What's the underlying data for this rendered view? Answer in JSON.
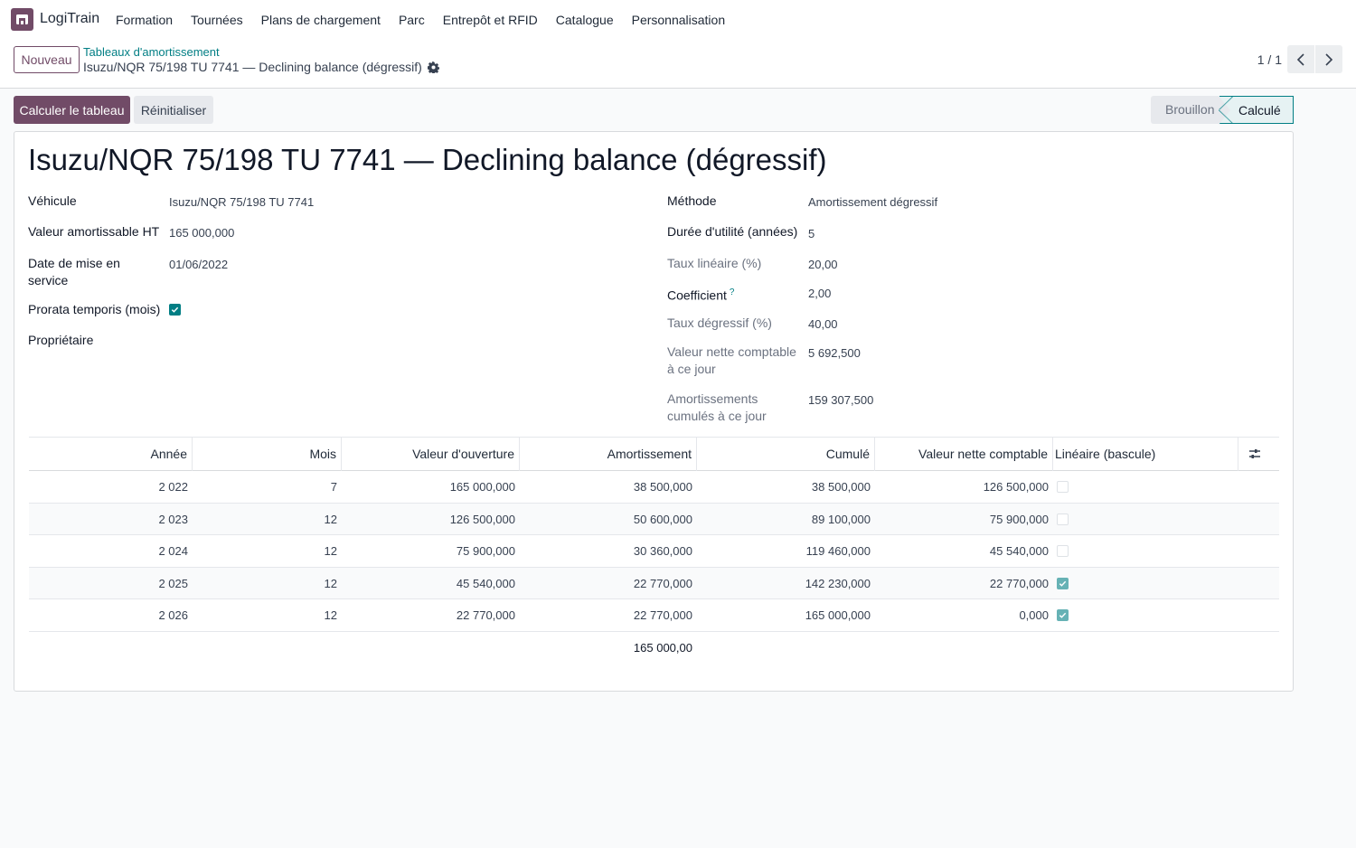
{
  "app": {
    "name": "LogiTrain"
  },
  "menu": [
    {
      "label": "Formation"
    },
    {
      "label": "Tournées"
    },
    {
      "label": "Plans de chargement"
    },
    {
      "label": "Parc"
    },
    {
      "label": "Entrepôt et RFID"
    },
    {
      "label": "Catalogue"
    },
    {
      "label": "Personnalisation"
    }
  ],
  "control": {
    "new_label": "Nouveau",
    "breadcrumb_parent": "Tableaux d'amortissement",
    "breadcrumb_current": "Isuzu/NQR 75/198 TU 7741 — Declining balance (dégressif)",
    "pager": "1 / 1"
  },
  "actions": {
    "compute_label": "Calculer le tableau",
    "reset_label": "Réinitialiser"
  },
  "status": {
    "draft": "Brouillon",
    "computed": "Calculé"
  },
  "colors": {
    "brand": "#714b67",
    "accent": "#017e84"
  },
  "form": {
    "title": "Isuzu/NQR 75/198 TU 7741 — Declining balance (dégressif)",
    "left": {
      "vehicle_label": "Véhicule",
      "vehicle": "Isuzu/NQR 75/198 TU 7741",
      "value_label": "Valeur amortissable HT",
      "value": "165 000,000",
      "date_label": "Date de mise en service",
      "date": "01/06/2022",
      "prorata_label": "Prorata temporis (mois)",
      "owner_label": "Propriétaire"
    },
    "right": {
      "method_label": "Méthode",
      "method": "Amortissement dégressif",
      "duration_label": "Durée d'utilité (années)",
      "duration": "5",
      "linear_rate_label": "Taux linéaire (%)",
      "linear_rate": "20,00",
      "coef_label": "Coefficient",
      "coef_help": "?",
      "coef": "2,00",
      "degr_rate_label": "Taux dégressif (%)",
      "degr_rate": "40,00",
      "nbv_label": "Valeur nette comptable à ce jour",
      "nbv": "5 692,500",
      "cum_label": "Amortissements cumulés à ce jour",
      "cum": "159 307,500"
    }
  },
  "table": {
    "headers": {
      "year": "Année",
      "months": "Mois",
      "opening": "Valeur d'ouverture",
      "depreciation": "Amortissement",
      "cumulative": "Cumulé",
      "nbv": "Valeur nette comptable",
      "linear": "Linéaire (bascule)"
    },
    "rows": [
      {
        "year": "2 022",
        "months": "7",
        "opening": "165 000,000",
        "depreciation": "38 500,000",
        "cumulative": "38 500,000",
        "nbv": "126 500,000",
        "linear": false
      },
      {
        "year": "2 023",
        "months": "12",
        "opening": "126 500,000",
        "depreciation": "50 600,000",
        "cumulative": "89 100,000",
        "nbv": "75 900,000",
        "linear": false
      },
      {
        "year": "2 024",
        "months": "12",
        "opening": "75 900,000",
        "depreciation": "30 360,000",
        "cumulative": "119 460,000",
        "nbv": "45 540,000",
        "linear": false
      },
      {
        "year": "2 025",
        "months": "12",
        "opening": "45 540,000",
        "depreciation": "22 770,000",
        "cumulative": "142 230,000",
        "nbv": "22 770,000",
        "linear": true
      },
      {
        "year": "2 026",
        "months": "12",
        "opening": "22 770,000",
        "depreciation": "22 770,000",
        "cumulative": "165 000,000",
        "nbv": "0,000",
        "linear": true
      }
    ],
    "total_depreciation": "165 000,00"
  }
}
